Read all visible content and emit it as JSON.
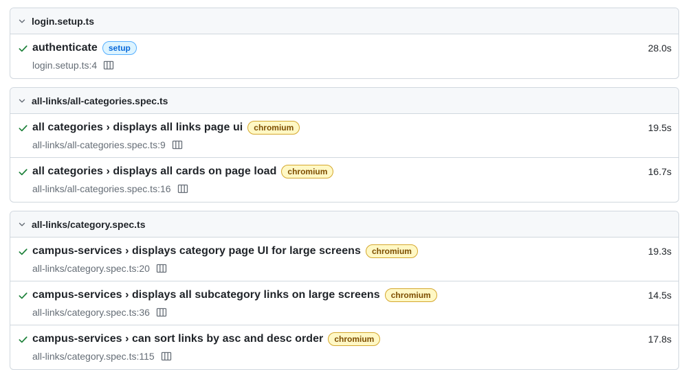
{
  "groups": [
    {
      "file": "login.setup.ts",
      "tests": [
        {
          "title": "authenticate",
          "project": "setup",
          "location": "login.setup.ts:4",
          "duration": "28.0s"
        }
      ]
    },
    {
      "file": "all-links/all-categories.spec.ts",
      "tests": [
        {
          "title": "all categories › displays all links page ui",
          "project": "chromium",
          "location": "all-links/all-categories.spec.ts:9",
          "duration": "19.5s"
        },
        {
          "title": "all categories › displays all cards on page load",
          "project": "chromium",
          "location": "all-links/all-categories.spec.ts:16",
          "duration": "16.7s"
        }
      ]
    },
    {
      "file": "all-links/category.spec.ts",
      "tests": [
        {
          "title": "campus-services › displays category page UI for large screens",
          "project": "chromium",
          "location": "all-links/category.spec.ts:20",
          "duration": "19.3s"
        },
        {
          "title": "campus-services › displays all subcategory links on large screens",
          "project": "chromium",
          "location": "all-links/category.spec.ts:36",
          "duration": "14.5s"
        },
        {
          "title": "campus-services › can sort links by asc and desc order",
          "project": "chromium",
          "location": "all-links/category.spec.ts:115",
          "duration": "17.8s"
        }
      ]
    }
  ],
  "colors": {
    "passed": "#1a7f37",
    "setup_badge": "#0969da",
    "chromium_badge": "#7d4e00",
    "border": "#d0d7de",
    "header_bg": "#f6f8fa"
  },
  "icons": {
    "group_toggle": "chevron-down-icon",
    "status": "check-icon",
    "trace": "trace-viewer-icon"
  }
}
